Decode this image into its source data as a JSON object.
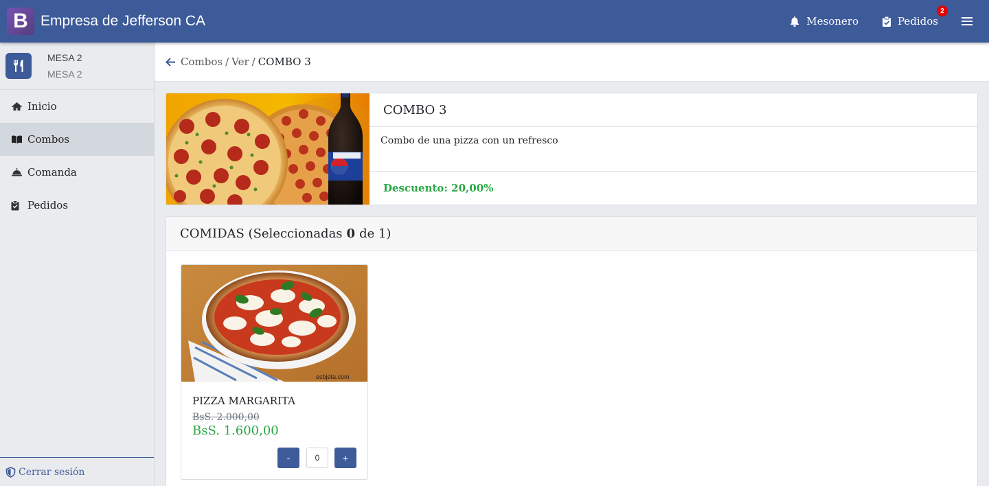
{
  "header": {
    "logo_letter": "B",
    "company": "Empresa de Jefferson CA",
    "mesonero_label": "Mesonero",
    "pedidos_label": "Pedidos",
    "pedidos_badge": "2",
    "brand_color": "#3d5a99"
  },
  "sidebar": {
    "mesa_title": "MESA 2",
    "mesa_subtitle": "MESA 2",
    "items": [
      {
        "label": "Inicio",
        "icon": "home-icon"
      },
      {
        "label": "Combos",
        "icon": "book-icon",
        "active": true
      },
      {
        "label": "Comanda",
        "icon": "bell-dish-icon"
      },
      {
        "label": "Pedidos",
        "icon": "clipboard-check-icon"
      }
    ],
    "logout_label": "Cerrar sesión"
  },
  "breadcrumb": {
    "items": [
      "Combos",
      "Ver"
    ],
    "current": "COMBO 3"
  },
  "combo": {
    "title": "COMBO 3",
    "description": "Combo de una pizza con un refresco",
    "discount": "Descuento: 20,00%"
  },
  "comidas": {
    "title_prefix": "COMIDAS (Seleccionadas",
    "selected": "0",
    "title_suffix": "de 1)",
    "items": [
      {
        "name": "PIZZA MARGARITA",
        "old_price": "BsS. 2.000,00",
        "price": "BsS. 1.600,00",
        "quantity": "0",
        "minus_label": "-",
        "plus_label": "+",
        "image_watermark": "esbjeta.com"
      }
    ]
  },
  "colors": {
    "accent": "#3d5a99",
    "success": "#28a745",
    "badge": "#e60000"
  }
}
